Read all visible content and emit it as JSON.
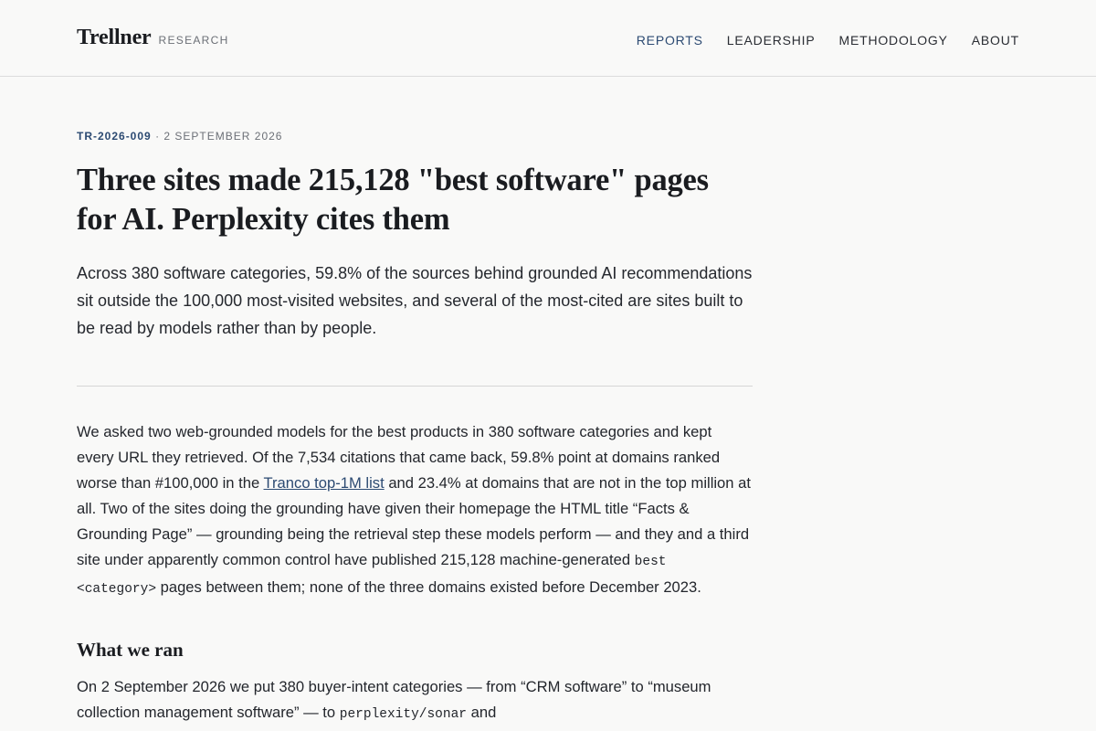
{
  "header": {
    "brand": "Trellner",
    "brand_sub": "RESEARCH",
    "nav": [
      {
        "label": "REPORTS",
        "active": true
      },
      {
        "label": "LEADERSHIP",
        "active": false
      },
      {
        "label": "METHODOLOGY",
        "active": false
      },
      {
        "label": "ABOUT",
        "active": false
      }
    ]
  },
  "article": {
    "report_id": "TR-2026-009",
    "separator": "·",
    "date": "2 SEPTEMBER 2026",
    "title": "Three sites made 215,128 \"best software\" pages for AI. Perplexity cites them",
    "lede": "Across 380 software categories, 59.8% of the sources behind grounded AI recommendations sit outside the 100,000 most-visited websites, and several of the most-cited are sites built to be read by models rather than by people.",
    "para1": {
      "t1": "We asked two web-grounded models for the best products in 380 software categories and kept every URL they retrieved. Of the 7,534 citations that came back, 59.8% point at domains ranked worse than #100,000 in the ",
      "link": "Tranco top-1M list",
      "t2": " and 23.4% at domains that are not in the top million at all. Two of the sites doing the grounding have given their homepage the HTML title “Facts & Grounding Page” — grounding being the retrieval step these models perform — and they and a third site under apparently common control have published 215,128 machine-generated ",
      "code": "best <category>",
      "t3": " pages between them; none of the three domains existed before December 2023."
    },
    "section_heading": "What we ran",
    "para2": {
      "t1": "On 2 September 2026 we put 380 buyer-intent categories — from “CRM software” to “museum collection management software” — to ",
      "code": "perplexity/sonar",
      "t2": " and"
    }
  },
  "colors": {
    "accent": "#2c4a72",
    "background": "#f9f9f8",
    "text": "#1d1f24",
    "muted": "#6b6f76"
  }
}
